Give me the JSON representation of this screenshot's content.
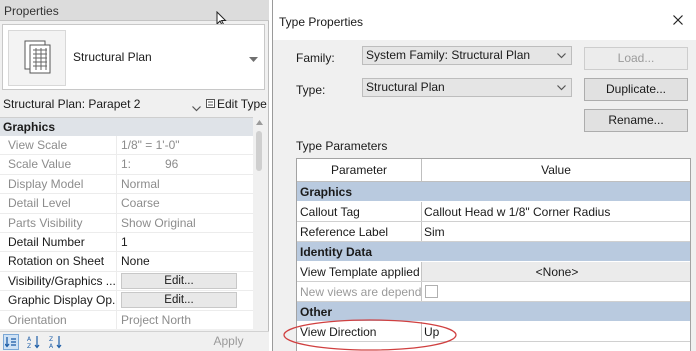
{
  "properties": {
    "title": "Properties",
    "type_name": "Structural Plan",
    "instance_name": "Structural Plan: Parapet 2",
    "edit_type_label": "Edit Type",
    "section": "Graphics",
    "rows": [
      {
        "name": "View Scale",
        "value": "1/8\" = 1'-0\"",
        "disabled": true
      },
      {
        "name": "Scale Value",
        "unit": "1:",
        "value": "96",
        "disabled": true
      },
      {
        "name": "Display Model",
        "value": "Normal",
        "disabled": true
      },
      {
        "name": "Detail Level",
        "value": "Coarse",
        "disabled": true
      },
      {
        "name": "Parts Visibility",
        "value": "Show Original",
        "disabled": true
      },
      {
        "name": "Detail Number",
        "value": "1",
        "disabled": false
      },
      {
        "name": "Rotation on Sheet",
        "value": "None",
        "disabled": false
      },
      {
        "name": "Visibility/Graphics ...",
        "value": "Edit...",
        "disabled": false,
        "button": true
      },
      {
        "name": "Graphic Display Op...",
        "value": "Edit...",
        "disabled": false,
        "button": true
      },
      {
        "name": "Orientation",
        "value": "Project North",
        "disabled": true
      }
    ],
    "apply_label": "Apply"
  },
  "dialog": {
    "title": "Type Properties",
    "family_label": "Family:",
    "family_value": "System Family: Structural Plan",
    "type_label": "Type:",
    "type_value": "Structural Plan",
    "load_label": "Load...",
    "duplicate_label": "Duplicate...",
    "rename_label": "Rename...",
    "type_parameters_label": "Type Parameters",
    "col_parameter": "Parameter",
    "col_value": "Value",
    "sections": [
      {
        "name": "Graphics",
        "rows": [
          {
            "param": "Callout Tag",
            "value": "Callout Head w 1/8\" Corner Radius"
          },
          {
            "param": "Reference Label",
            "value": "Sim"
          }
        ]
      },
      {
        "name": "Identity Data",
        "rows": [
          {
            "param": "View Template applied",
            "value": "<None>"
          },
          {
            "param": "New views are depende",
            "value": ""
          }
        ]
      },
      {
        "name": "Other",
        "rows": [
          {
            "param": "View Direction",
            "value": "Up"
          }
        ]
      }
    ]
  },
  "colors": {
    "section_band": "#b9cadf",
    "annotation_ellipse": "#d04040"
  }
}
